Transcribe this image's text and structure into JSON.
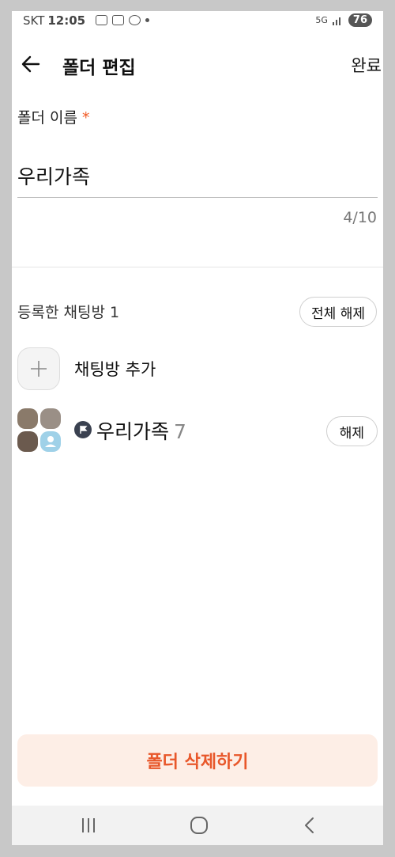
{
  "status_bar": {
    "carrier": "SKT",
    "time": "12:05",
    "network": "5G",
    "battery": "76"
  },
  "header": {
    "title": "폴더 편집",
    "done_label": "완료"
  },
  "folder_name": {
    "label": "폴더 이름",
    "required_mark": "*",
    "value": "우리가족",
    "counter": "4/10"
  },
  "section": {
    "title": "등록한 채팅방 1",
    "unregister_all_label": "전체 해제",
    "add_label": "채팅방 추가"
  },
  "chat_rooms": [
    {
      "name": "우리가족",
      "member_count": "7",
      "unregister_label": "해제"
    }
  ],
  "delete_button": {
    "label": "폴더 삭제하기"
  },
  "colors": {
    "accent": "#e8572a",
    "delete_bg": "#fdeee6",
    "required": "#f15a24"
  },
  "icons": [
    "back-arrow-icon",
    "plus-icon",
    "flag-icon",
    "recent-apps-icon",
    "home-icon",
    "nav-back-icon"
  ]
}
